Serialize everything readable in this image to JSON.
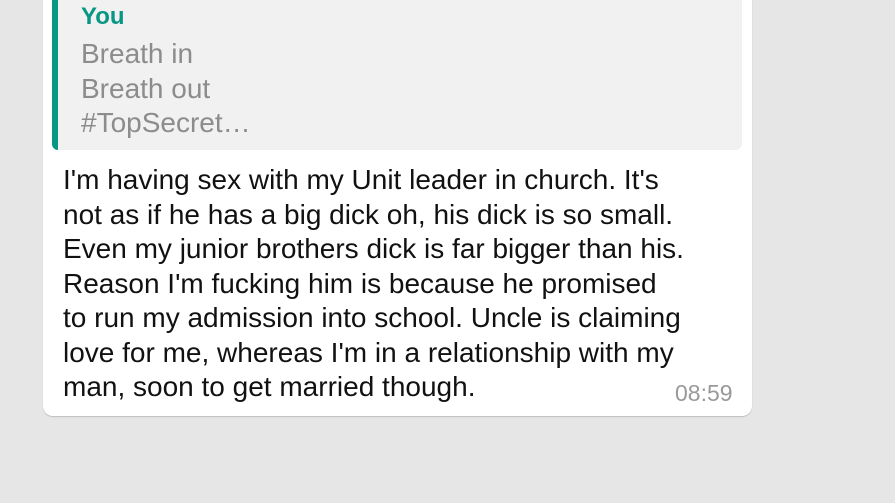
{
  "reply": {
    "author": "You",
    "lines": [
      "Breath in",
      "Breath out",
      "#TopSecret…"
    ],
    "accent_color": "#079784"
  },
  "message": {
    "lines": [
      "I'm having sex with my Unit leader in church. It's",
      "not as if he has a big dick oh, his dick is so small.",
      "Even my junior brothers dick is far bigger than his.",
      "Reason I'm fucking him is because he promised",
      "to run my admission into school. Uncle is claiming",
      "love for me, whereas I'm in a relationship with my",
      "man, soon to get married though."
    ],
    "time": "08:59"
  }
}
